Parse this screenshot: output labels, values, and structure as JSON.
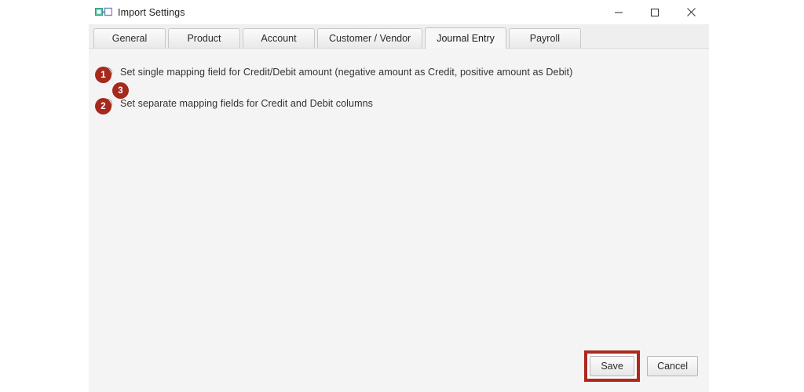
{
  "window": {
    "title": "Import Settings",
    "icon": "import-settings-icon",
    "controls": {
      "minimize": "minimize-icon",
      "maximize": "maximize-icon",
      "close": "close-icon"
    }
  },
  "tabs": [
    {
      "label": "General",
      "active": false
    },
    {
      "label": "Product",
      "active": false
    },
    {
      "label": "Account",
      "active": false
    },
    {
      "label": "Customer / Vendor",
      "active": false
    },
    {
      "label": "Journal Entry",
      "active": true
    },
    {
      "label": "Payroll",
      "active": false
    }
  ],
  "options": [
    {
      "label": "Set single mapping field for Credit/Debit amount (negative amount as Credit, positive amount as Debit)",
      "selected": false
    },
    {
      "label": "Set separate mapping fields for Credit and Debit columns",
      "selected": false
    }
  ],
  "annotations": [
    {
      "number": "1"
    },
    {
      "number": "2"
    },
    {
      "number": "3"
    }
  ],
  "footer": {
    "save_label": "Save",
    "cancel_label": "Cancel"
  },
  "colors": {
    "annotation_red": "#a5291d",
    "highlight_red": "#ae281c",
    "content_background": "#f4f4f4",
    "icon_teal": "#3fbfa0",
    "icon_blue": "#6a7fc8"
  }
}
